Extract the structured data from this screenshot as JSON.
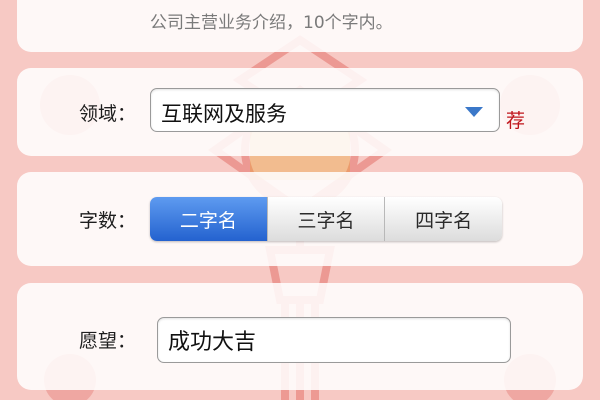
{
  "intro": {
    "hint": "公司主营业务介绍，10个字内。"
  },
  "domain": {
    "label": "领域：",
    "value": "互联网及服务",
    "recommend_label": "荐"
  },
  "char_count": {
    "label": "字数：",
    "options": [
      "二字名",
      "三字名",
      "四字名"
    ],
    "selected": "二字名"
  },
  "wish": {
    "label": "愿望：",
    "value": "成功大吉"
  },
  "background": {
    "decoration_icons": [
      "chinese-knot-icon",
      "fu-character-icon"
    ]
  },
  "colors": {
    "accent": "#2f6fd8",
    "recommend": "#c0141b",
    "background": "#f7c9c4"
  }
}
